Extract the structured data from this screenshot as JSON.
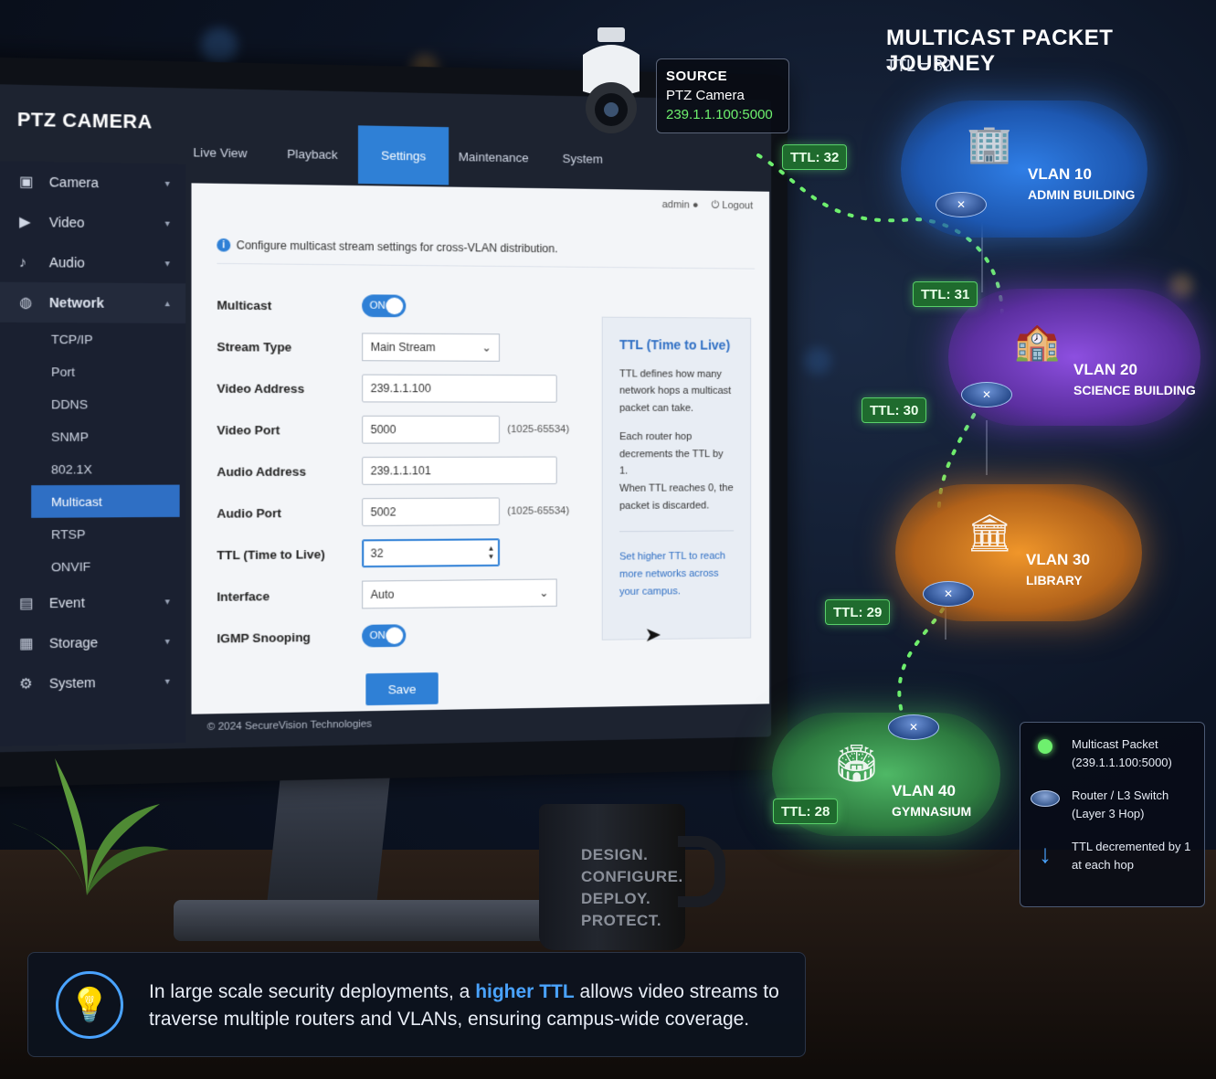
{
  "camera_ui": {
    "title": "PTZ CAMERA",
    "tabs": [
      "Live View",
      "Playback",
      "Settings",
      "Maintenance",
      "System"
    ],
    "active_tab": "Settings",
    "user": "admin",
    "logout": "Logout",
    "sidebar": [
      {
        "label": "Camera",
        "icon": "camera-icon"
      },
      {
        "label": "Video",
        "icon": "video-icon"
      },
      {
        "label": "Audio",
        "icon": "audio-icon"
      },
      {
        "label": "Network",
        "icon": "globe-icon"
      }
    ],
    "network_sub": [
      "TCP/IP",
      "Port",
      "DDNS",
      "SNMP",
      "802.1X",
      "Multicast",
      "RTSP",
      "ONVIF"
    ],
    "active_sub": "Multicast",
    "sidebar_bottom": [
      {
        "label": "Event",
        "icon": "event-icon"
      },
      {
        "label": "Storage",
        "icon": "storage-icon"
      },
      {
        "label": "System",
        "icon": "gear-icon"
      }
    ],
    "info": "Configure multicast stream settings for cross-VLAN distribution.",
    "form": {
      "multicast_label": "Multicast",
      "multicast_toggle": "ON",
      "stream_type_label": "Stream Type",
      "stream_type_value": "Main Stream",
      "video_address_label": "Video Address",
      "video_address_value": "239.1.1.100",
      "video_port_label": "Video Port",
      "video_port_value": "5000",
      "port_range": "(1025-65534)",
      "audio_address_label": "Audio Address",
      "audio_address_value": "239.1.1.101",
      "audio_port_label": "Audio Port",
      "audio_port_value": "5002",
      "ttl_label": "TTL (Time to Live)",
      "ttl_value": "32",
      "interface_label": "Interface",
      "interface_value": "Auto",
      "igmp_label": "IGMP Snooping",
      "igmp_toggle": "ON",
      "save": "Save"
    },
    "ttl_panel": {
      "title": "TTL (Time to Live)",
      "p1": "TTL defines how many network hops a multicast packet can take.",
      "p2": "Each router hop decrements the TTL by 1.",
      "p3": "When TTL reaches 0, the packet is discarded.",
      "link": "Set higher TTL to reach more networks across your campus."
    },
    "footer": "© 2024 SecureVision Technologies"
  },
  "mug": {
    "lines": [
      "DESIGN.",
      "CONFIGURE.",
      "DEPLOY.",
      "PROTECT."
    ]
  },
  "source": {
    "title": "SOURCE",
    "device": "PTZ Camera",
    "address": "239.1.1.100:5000"
  },
  "journey": {
    "title": "MULTICAST PACKET JOURNEY",
    "subtitle": "TTL = 32",
    "ttl_badges": [
      "TTL: 32",
      "TTL: 31",
      "TTL: 30",
      "TTL: 29",
      "TTL: 28"
    ],
    "vlans": [
      {
        "name": "VLAN 10",
        "place": "ADMIN BUILDING",
        "color": "#2a6fd6"
      },
      {
        "name": "VLAN 20",
        "place": "SCIENCE BUILDING",
        "color": "#7a3fd0"
      },
      {
        "name": "VLAN 30",
        "place": "LIBRARY",
        "color": "#d9821f"
      },
      {
        "name": "VLAN 40",
        "place": "GYMNASIUM",
        "color": "#3fa65a"
      }
    ]
  },
  "legend": [
    {
      "icon": "packet-dot-icon",
      "l1": "Multicast Packet",
      "l2": "(239.1.1.100:5000)"
    },
    {
      "icon": "router-icon",
      "l1": "Router / L3 Switch",
      "l2": "(Layer 3 Hop)"
    },
    {
      "icon": "down-arrow-icon",
      "l1": "TTL decremented by 1",
      "l2": "at each hop"
    }
  ],
  "tip": {
    "pre": "In large scale security deployments, a ",
    "highlight": "higher TTL",
    "post": " allows video streams to traverse multiple routers and VLANs, ensuring campus-wide coverage."
  }
}
